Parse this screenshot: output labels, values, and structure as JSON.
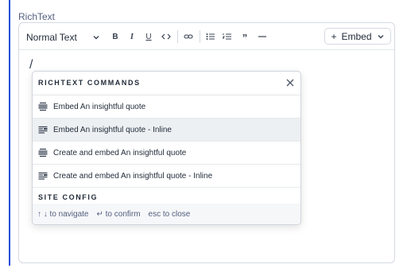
{
  "field": {
    "label": "RichText"
  },
  "toolbar": {
    "style_select": "Normal Text",
    "embed_label": "Embed",
    "embed_prefix": "+"
  },
  "editor": {
    "content": "/"
  },
  "popup": {
    "title": "RICHTEXT COMMANDS",
    "items": [
      {
        "label": "Embed An insightful quote",
        "icon": "embed-block-icon"
      },
      {
        "label": "Embed An insightful quote - Inline",
        "icon": "embed-inline-icon"
      },
      {
        "label": "Create and embed An insightful quote",
        "icon": "embed-block-icon"
      },
      {
        "label": "Create and embed An insightful quote - Inline",
        "icon": "embed-inline-icon"
      }
    ],
    "section": "SITE CONFIG",
    "hints": {
      "navigate": "↑ ↓ to navigate",
      "confirm": "↵ to confirm",
      "close": "esc to close"
    }
  }
}
